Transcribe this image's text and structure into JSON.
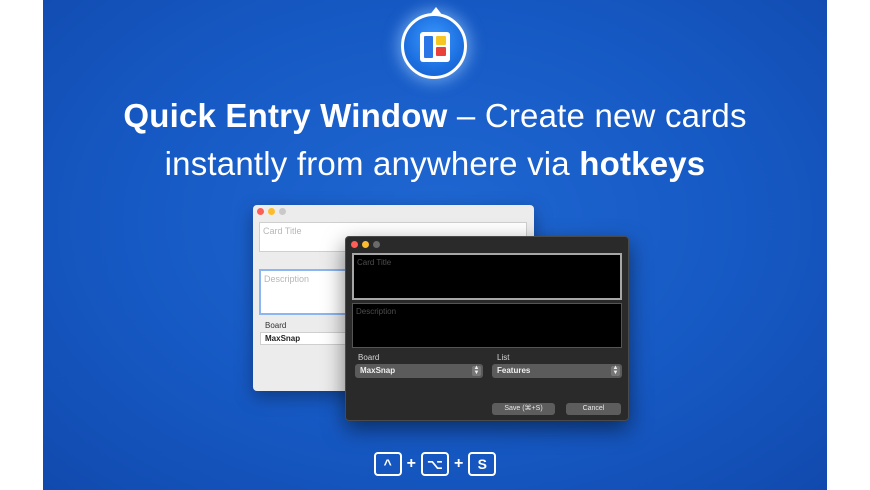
{
  "headline": {
    "line1_bold": "Quick Entry Window",
    "line1_rest": " – Create new cards",
    "line2_rest": "instantly from anywhere via ",
    "line2_bold": "hotkeys"
  },
  "light_window": {
    "title_placeholder": "Card Title",
    "description_placeholder": "Description",
    "board_label": "Board",
    "board_value": "MaxSnap"
  },
  "dark_window": {
    "title_placeholder": "Card Title",
    "description_placeholder": "Description",
    "board_label": "Board",
    "board_value": "MaxSnap",
    "list_label": "List",
    "list_value": "Features",
    "save_label": "Save (⌘+S)",
    "cancel_label": "Cancel"
  },
  "hotkeys": {
    "keys": [
      "^",
      "⌥",
      "S"
    ],
    "separator": "+"
  },
  "colors": {
    "background": "#1659c4",
    "accent": "#2a76e6"
  },
  "icons": {
    "app": "kanban-board-app-icon",
    "control": "control-key-icon",
    "option": "option-key-icon"
  }
}
